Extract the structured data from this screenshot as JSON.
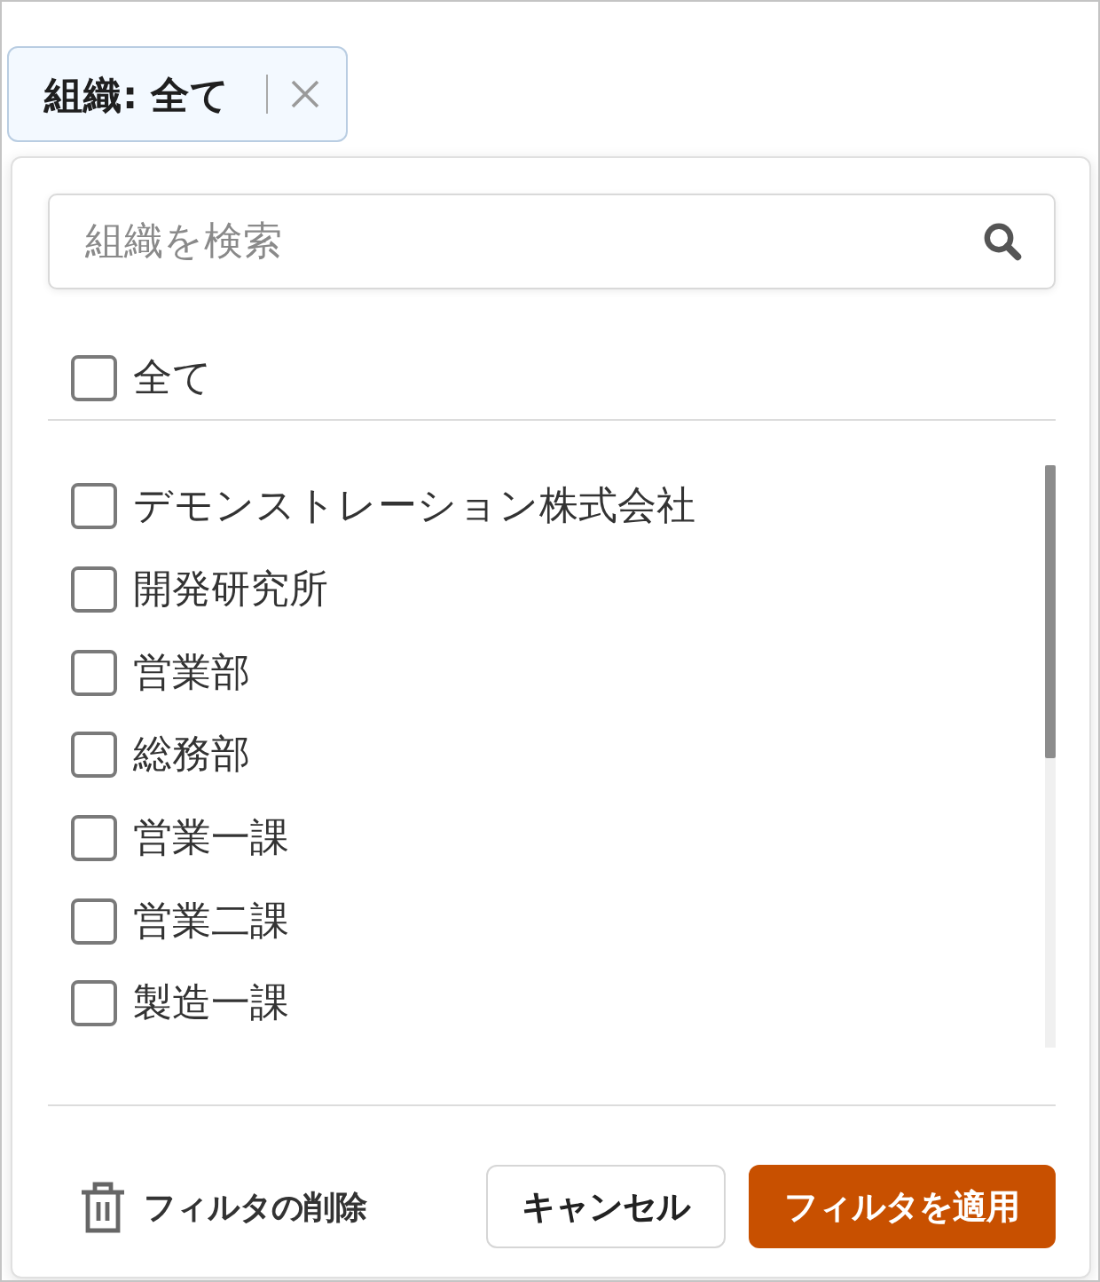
{
  "filter_chip": {
    "label": "組織: 全て"
  },
  "search": {
    "placeholder": "組織を検索"
  },
  "select_all": {
    "label": "全て",
    "checked": false
  },
  "options": [
    {
      "label": "デモンストレーション株式会社",
      "checked": false
    },
    {
      "label": "開発研究所",
      "checked": false
    },
    {
      "label": "営業部",
      "checked": false
    },
    {
      "label": "総務部",
      "checked": false
    },
    {
      "label": "営業一課",
      "checked": false
    },
    {
      "label": "営業二課",
      "checked": false
    },
    {
      "label": "製造一課",
      "checked": false
    }
  ],
  "footer": {
    "clear_button": "フィルタの削除",
    "cancel_button": "キャンセル",
    "apply_button": "フィルタを適用"
  }
}
